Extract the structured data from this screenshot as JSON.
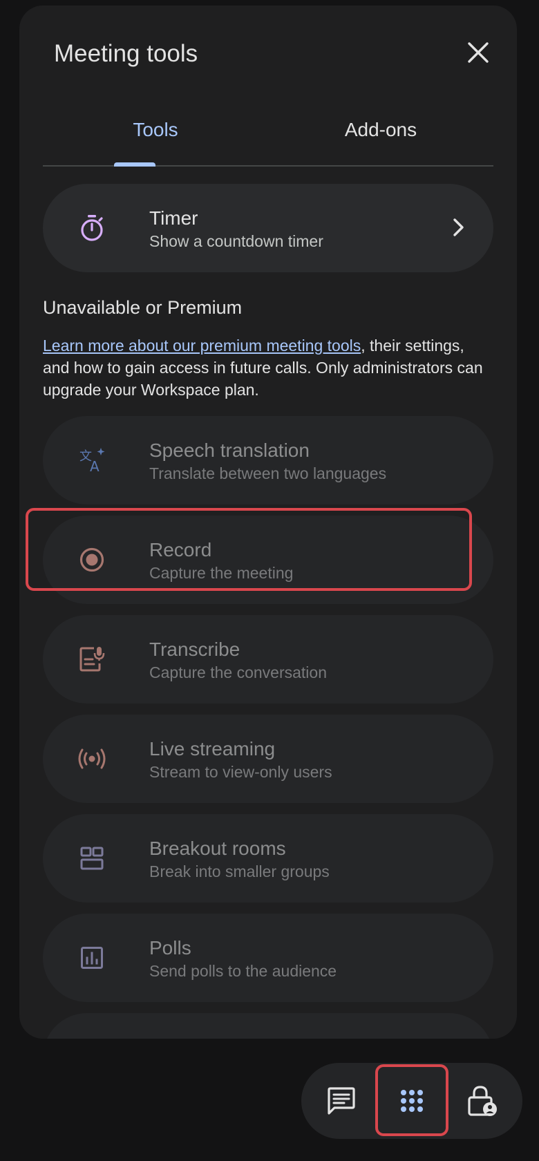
{
  "panel": {
    "title": "Meeting tools",
    "close_label": "Close"
  },
  "tabs": [
    {
      "label": "Tools",
      "active": true
    },
    {
      "label": "Add-ons",
      "active": false
    }
  ],
  "timer": {
    "title": "Timer",
    "subtitle": "Show a countdown timer",
    "icon": "timer-icon"
  },
  "unavailable": {
    "heading": "Unavailable or Premium",
    "link_text": "Learn more about our premium meeting tools",
    "desc_rest": ", their settings, and how to gain access in future calls. Only administrators can upgrade your Workspace plan."
  },
  "premium_tools": [
    {
      "title": "Speech translation",
      "subtitle": "Translate between two languages",
      "icon": "translate-icon"
    },
    {
      "title": "Record",
      "subtitle": "Capture the meeting",
      "icon": "record-icon"
    },
    {
      "title": "Transcribe",
      "subtitle": "Capture the conversation",
      "icon": "transcribe-icon"
    },
    {
      "title": "Live streaming",
      "subtitle": "Stream to view-only users",
      "icon": "live-stream-icon"
    },
    {
      "title": "Breakout rooms",
      "subtitle": "Break into smaller groups",
      "icon": "breakout-rooms-icon"
    },
    {
      "title": "Polls",
      "subtitle": "Send polls to the audience",
      "icon": "polls-icon"
    }
  ],
  "bottom_bar": {
    "buttons": [
      "chat-icon",
      "apps-grid-icon",
      "host-controls-icon"
    ]
  },
  "colors": {
    "accent": "#a8c7fa",
    "highlight": "#d9474d",
    "panel_bg": "#1f1f20"
  }
}
